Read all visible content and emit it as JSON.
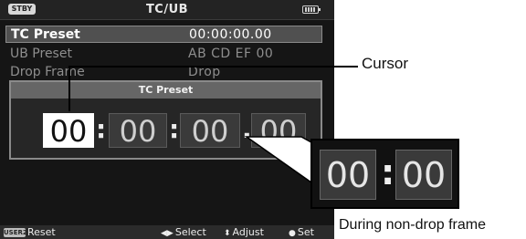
{
  "status_bar": {
    "mode_badge": "STBY",
    "title": "TC/UB",
    "battery_icon": "battery-icon"
  },
  "menu": {
    "items": [
      {
        "label": "TC Preset",
        "value": "00:00:00.00"
      },
      {
        "label": "UB Preset",
        "value": "AB CD EF 00"
      },
      {
        "label": "Drop Frame",
        "value": "Drop"
      }
    ]
  },
  "dialog": {
    "title": "TC Preset",
    "digits": [
      "00",
      "00",
      "00",
      "00"
    ],
    "separators": [
      ":",
      ":",
      "."
    ]
  },
  "bottom_bar": {
    "user_button_badge": "USER2",
    "reset": "Reset",
    "select_glyph": "◀▶",
    "select": "Select",
    "adjust_glyph": "⬍",
    "adjust": "Adjust",
    "set_glyph": "●",
    "set": "Set"
  },
  "callouts": {
    "cursor_label": "Cursor",
    "nondrop_label": "During non-drop frame",
    "nondrop_digits": [
      "00",
      "00"
    ],
    "nondrop_separator": ":"
  }
}
